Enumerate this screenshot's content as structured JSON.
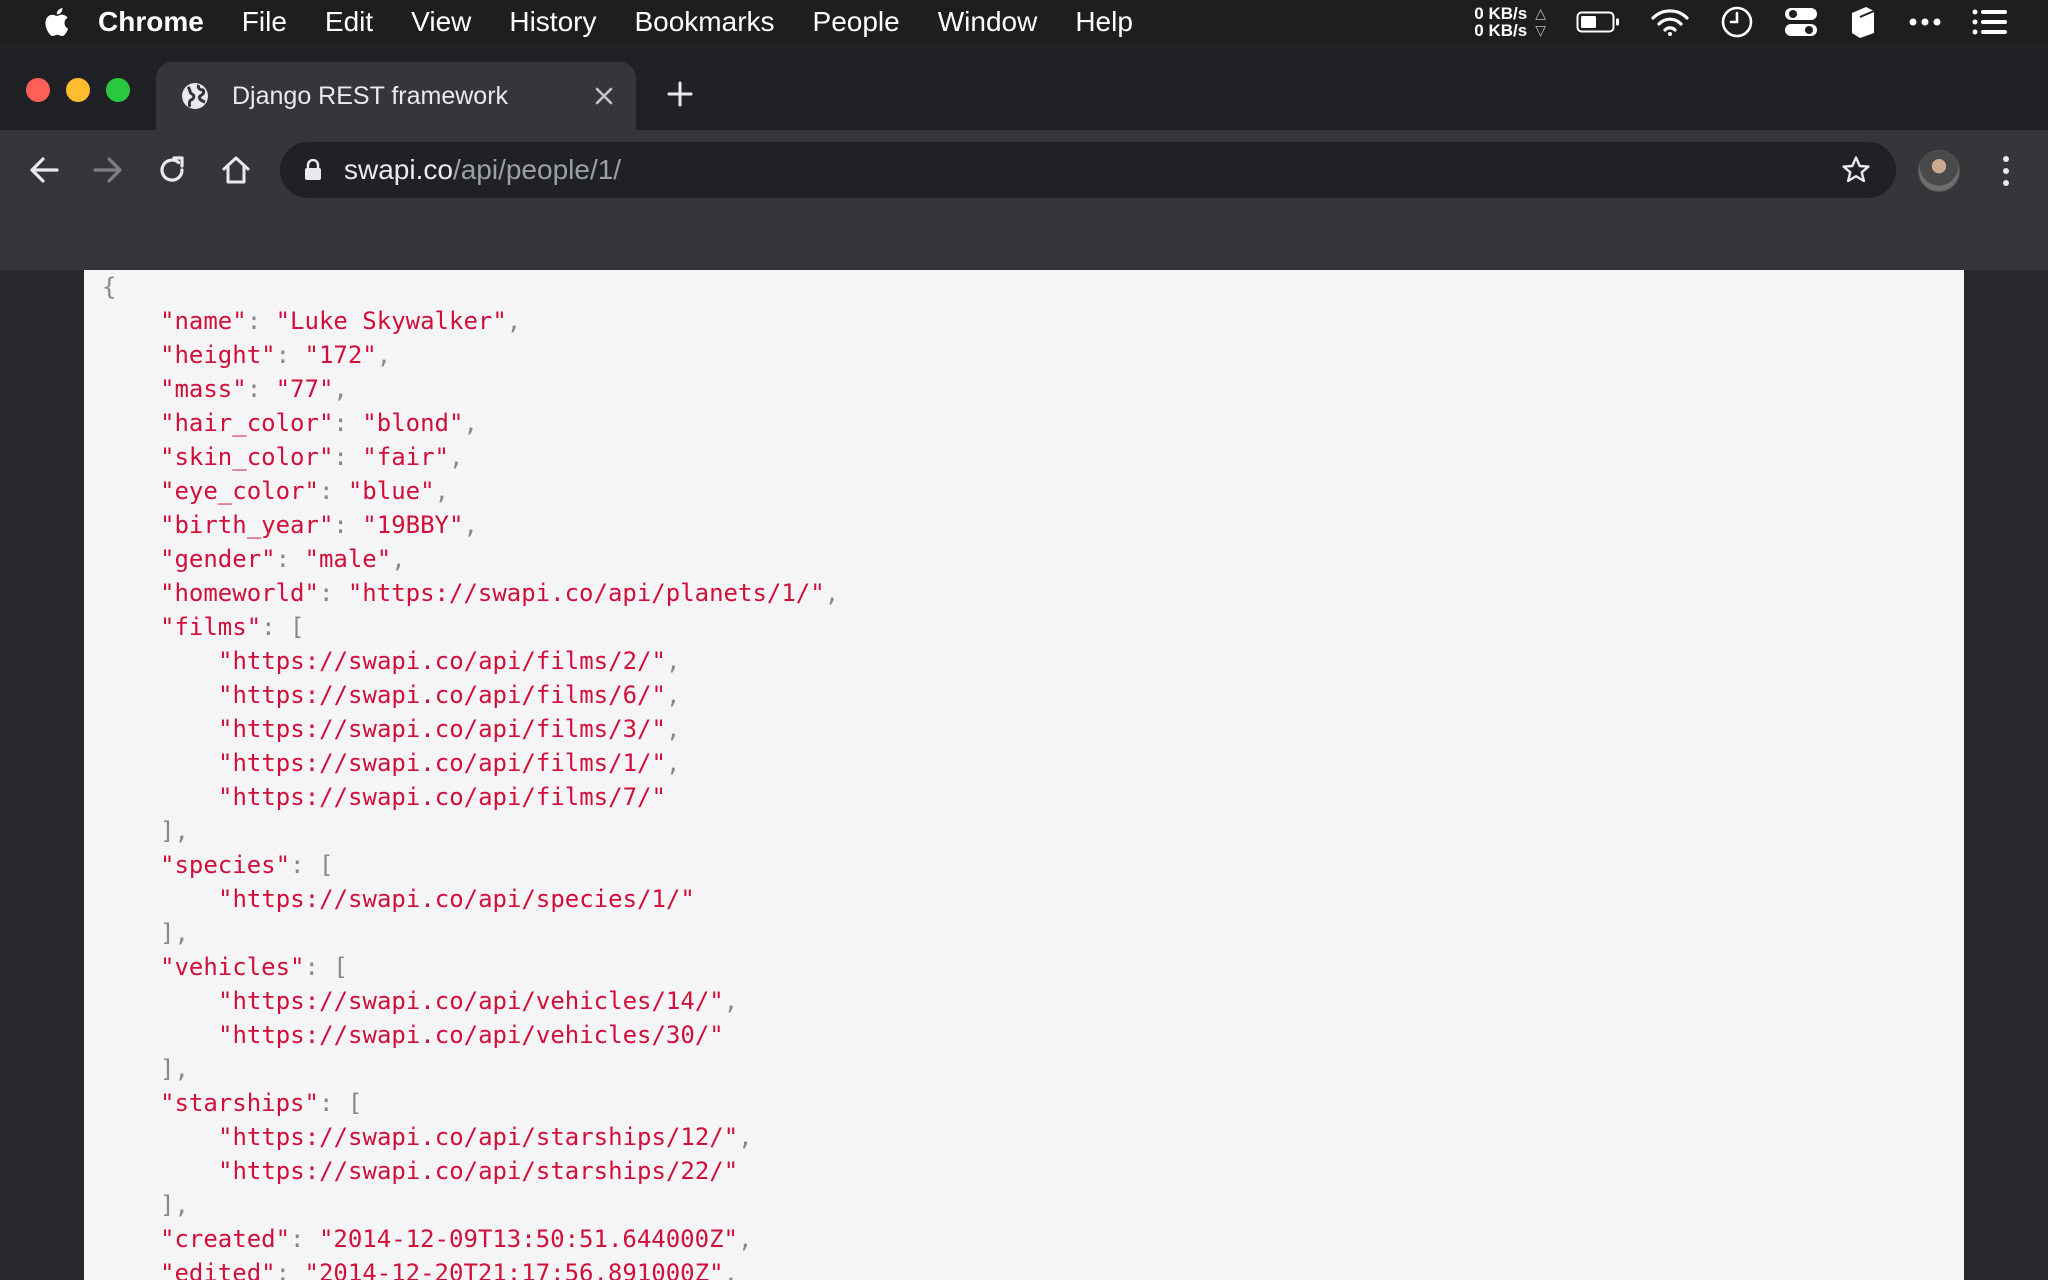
{
  "menubar": {
    "app_name": "Chrome",
    "items": [
      "File",
      "Edit",
      "View",
      "History",
      "Bookmarks",
      "People",
      "Window",
      "Help"
    ],
    "net_up": "0 KB/s",
    "net_down": "0 KB/s",
    "icons": [
      "apple-icon",
      "battery-icon",
      "wifi-icon",
      "clock-icon",
      "control-center-icon",
      "dropzone-icon",
      "more-icon",
      "notification-list-icon"
    ]
  },
  "tab": {
    "title": "Django REST framework"
  },
  "omnibox": {
    "host": "swapi.co",
    "path": "/api/people/1/"
  },
  "json": {
    "open_brace": "{",
    "fields": [
      {
        "key": "\"name\"",
        "value": "\"Luke Skywalker\""
      },
      {
        "key": "\"height\"",
        "value": "\"172\""
      },
      {
        "key": "\"mass\"",
        "value": "\"77\""
      },
      {
        "key": "\"hair_color\"",
        "value": "\"blond\""
      },
      {
        "key": "\"skin_color\"",
        "value": "\"fair\""
      },
      {
        "key": "\"eye_color\"",
        "value": "\"blue\""
      },
      {
        "key": "\"birth_year\"",
        "value": "\"19BBY\""
      },
      {
        "key": "\"gender\"",
        "value": "\"male\""
      },
      {
        "key": "\"homeworld\"",
        "value": "\"https://swapi.co/api/planets/1/\""
      }
    ],
    "films": {
      "key": "\"films\"",
      "items": [
        "\"https://swapi.co/api/films/2/\"",
        "\"https://swapi.co/api/films/6/\"",
        "\"https://swapi.co/api/films/3/\"",
        "\"https://swapi.co/api/films/1/\"",
        "\"https://swapi.co/api/films/7/\""
      ]
    },
    "species": {
      "key": "\"species\"",
      "items": [
        "\"https://swapi.co/api/species/1/\""
      ]
    },
    "vehicles": {
      "key": "\"vehicles\"",
      "items": [
        "\"https://swapi.co/api/vehicles/14/\"",
        "\"https://swapi.co/api/vehicles/30/\""
      ]
    },
    "starships": {
      "key": "\"starships\"",
      "items": [
        "\"https://swapi.co/api/starships/12/\"",
        "\"https://swapi.co/api/starships/22/\""
      ]
    },
    "created": {
      "key": "\"created\"",
      "value": "\"2014-12-09T13:50:51.644000Z\""
    },
    "edited": {
      "key": "\"edited\"",
      "value": "\"2014-12-20T21:17:56.891000Z\""
    }
  },
  "colors": {
    "json_string": "#d0103a",
    "json_punctuation": "#888888",
    "page_background": "#f5f5f7",
    "chrome_frame": "#202124",
    "chrome_toolbar": "#35363a"
  }
}
